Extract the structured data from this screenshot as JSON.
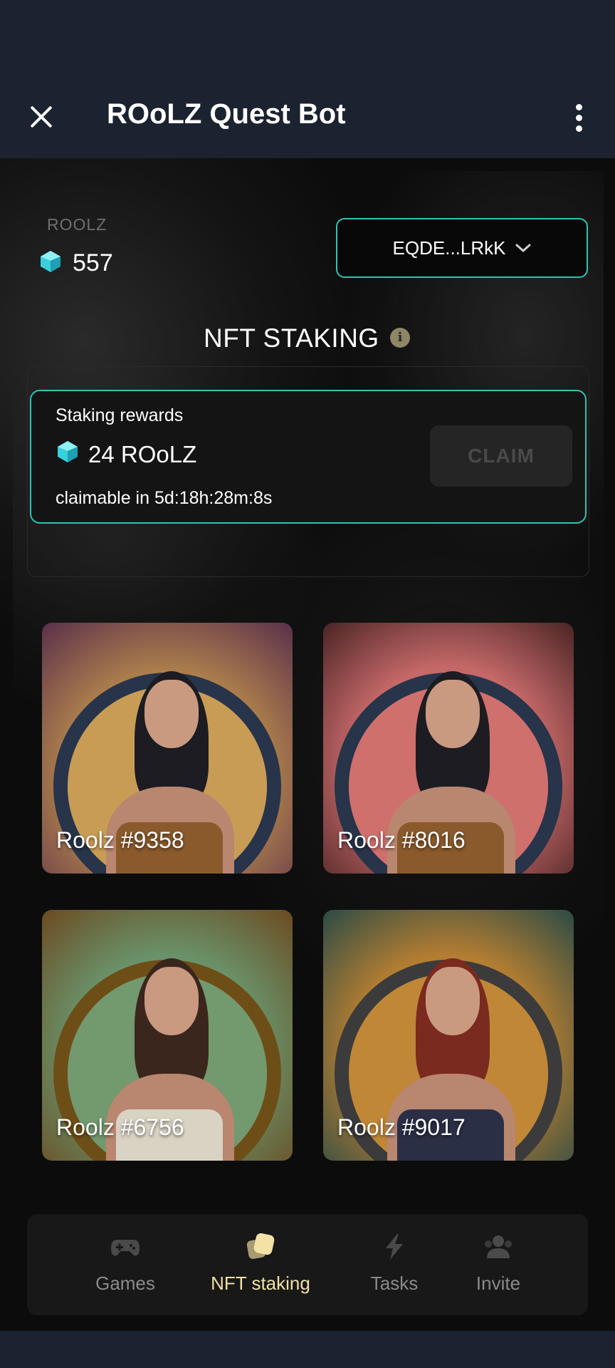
{
  "header": {
    "title": "ROoLZ Quest Bot"
  },
  "balance": {
    "label": "ROOLZ",
    "amount": "557"
  },
  "wallet": {
    "address": "EQDE...LRkK"
  },
  "staking": {
    "title": "NFT STAKING",
    "rewards_label": "Staking rewards",
    "rewards_amount": "24 ROoLZ",
    "claim_time": "claimable in 5d:18h:28m:8s",
    "claim_label": "CLAIM"
  },
  "nfts": [
    {
      "name": "Roolz #9358"
    },
    {
      "name": "Roolz #8016"
    },
    {
      "name": "Roolz #6756"
    },
    {
      "name": "Roolz #9017"
    }
  ],
  "nav": {
    "items": [
      {
        "label": "Games",
        "icon": "gamepad-icon"
      },
      {
        "label": "NFT staking",
        "icon": "nft-cards-icon",
        "active": true
      },
      {
        "label": "Tasks",
        "icon": "lightning-icon"
      },
      {
        "label": "Invite",
        "icon": "people-icon"
      }
    ]
  },
  "colors": {
    "accent": "#2fc3b5",
    "active_nav": "#f0e0a5",
    "header_bg": "#1b2330"
  }
}
